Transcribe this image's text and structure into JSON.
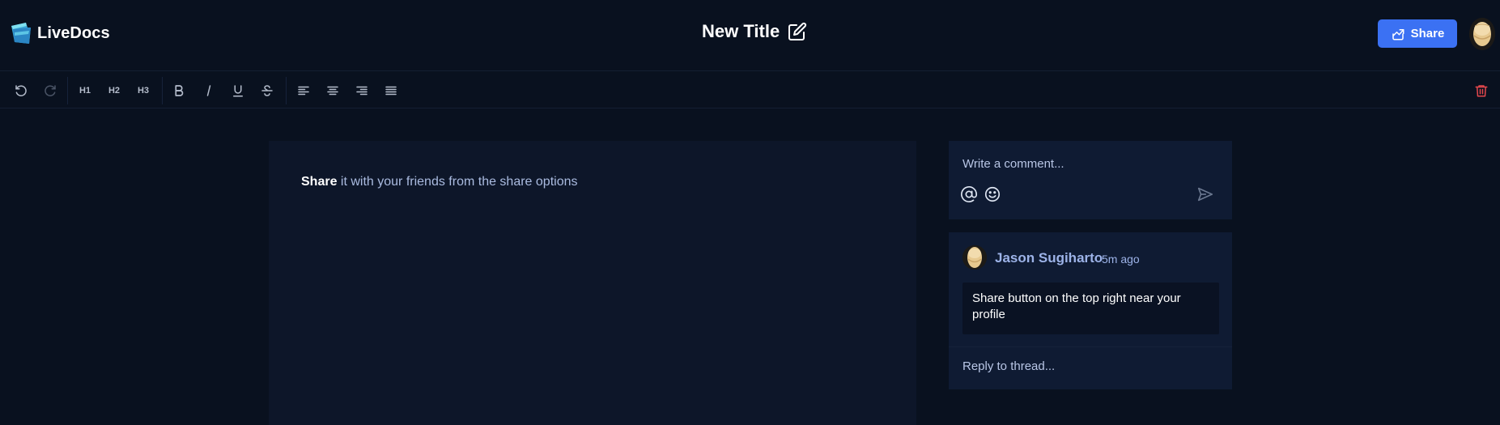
{
  "app": {
    "name": "LiveDocs",
    "logo_icon": "folder-logo-icon"
  },
  "header": {
    "title": "New Title",
    "edit_icon": "edit-icon",
    "share_label": "Share",
    "share_icon": "share-icon"
  },
  "toolbar": {
    "undo_icon": "undo-icon",
    "redo_icon": "redo-icon",
    "h1": "H1",
    "h2": "H2",
    "h3": "H3",
    "bold_icon": "bold-icon",
    "italic_icon": "italic-icon",
    "underline_icon": "underline-icon",
    "strikethrough_icon": "strikethrough-icon",
    "align_left_icon": "align-left-icon",
    "align_center_icon": "align-center-icon",
    "align_right_icon": "align-right-icon",
    "align_justify_icon": "align-justify-icon",
    "delete_icon": "trash-icon",
    "delete_color": "#e5484d"
  },
  "editor": {
    "bold_text": "Share",
    "text": " it with your friends from the share options"
  },
  "composer": {
    "placeholder": "Write a comment...",
    "mention_icon": "at-icon",
    "emoji_icon": "smiley-icon",
    "send_icon": "send-icon"
  },
  "thread": {
    "author": "Jason Sugiharto",
    "time": "5m ago",
    "body": "Share button on the top right near your profile",
    "reply_placeholder": "Reply to thread..."
  },
  "colors": {
    "background": "#09111f",
    "accent": "#3b71f3",
    "panel": "#0f1b33"
  }
}
